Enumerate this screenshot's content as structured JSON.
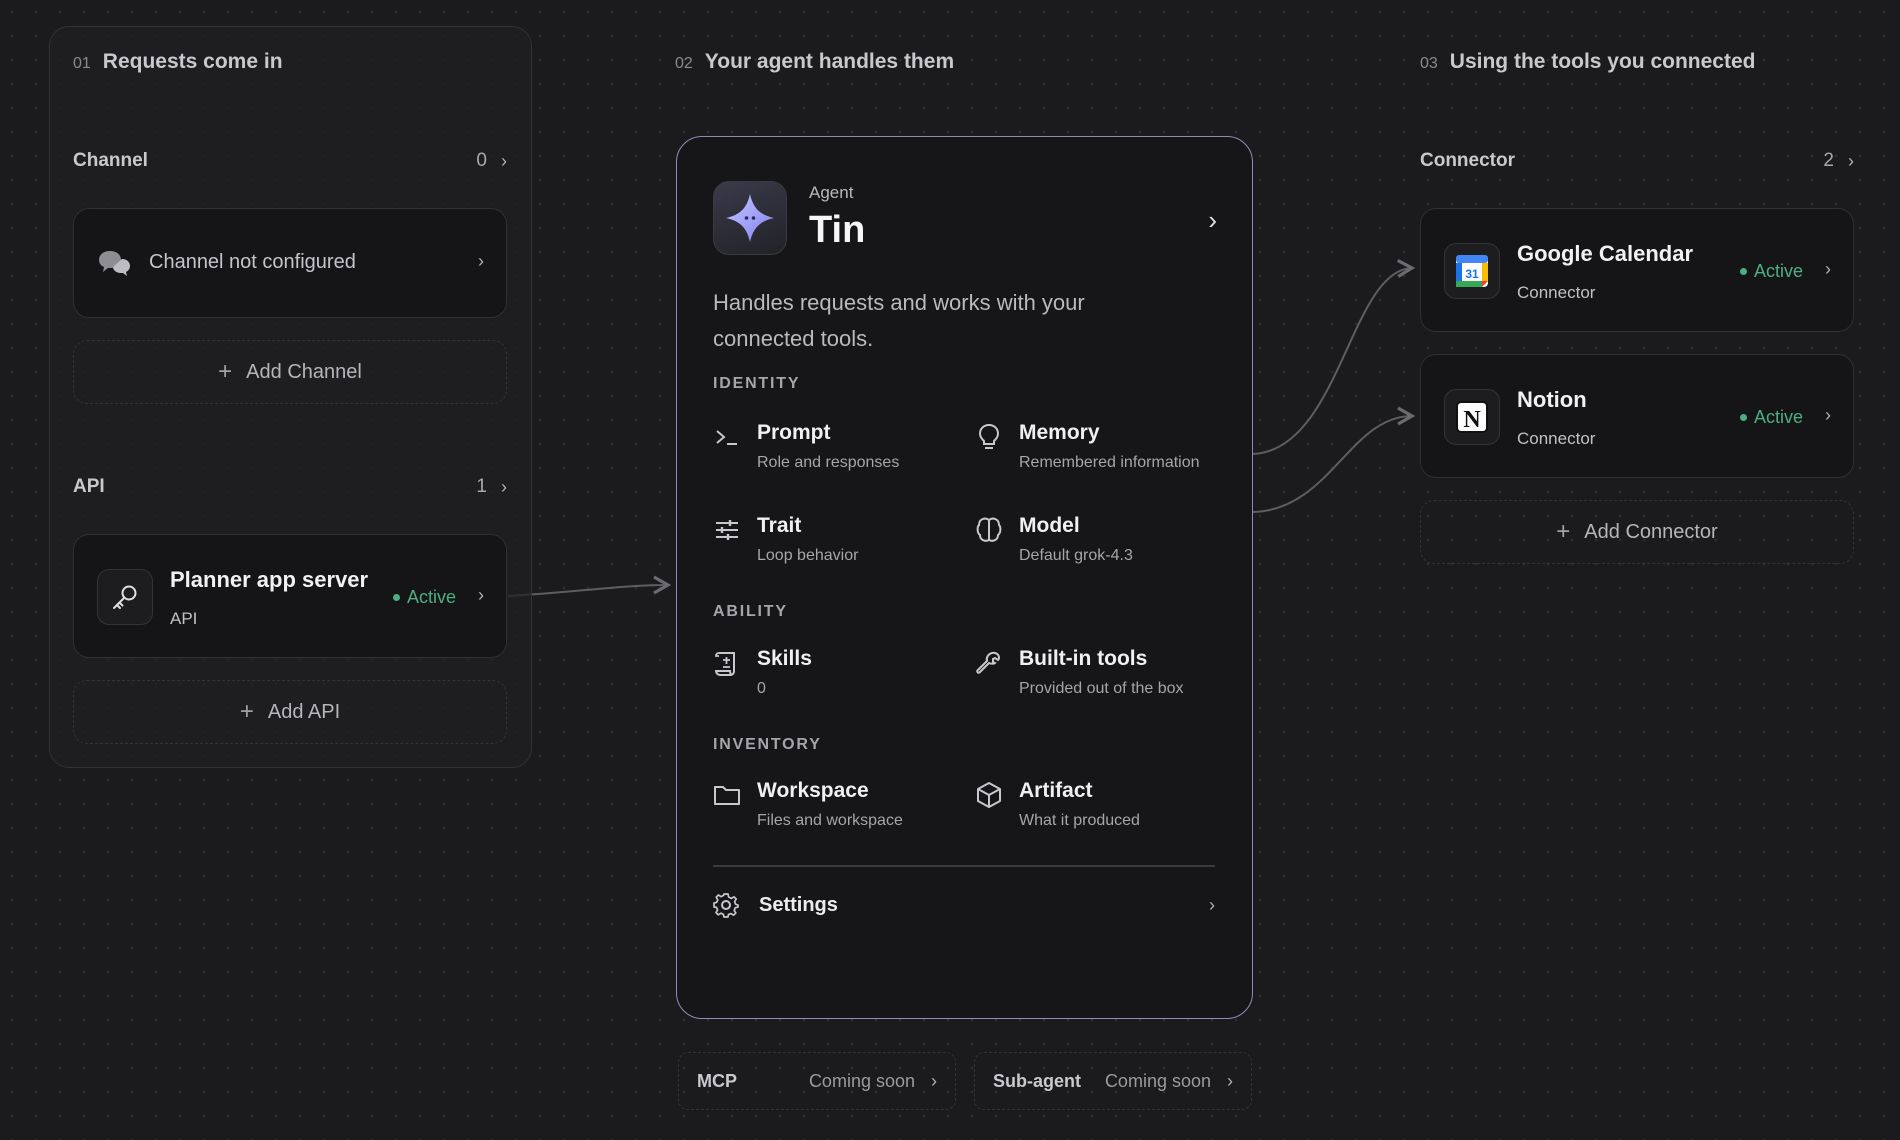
{
  "steps": [
    {
      "num": "01",
      "title": "Requests come in"
    },
    {
      "num": "02",
      "title": "Your agent handles them"
    },
    {
      "num": "03",
      "title": "Using the tools you connected"
    }
  ],
  "channel": {
    "label": "Channel",
    "count": "0",
    "empty_card": {
      "text": "Channel not configured",
      "icon": "chat-bubbles-icon"
    },
    "add_label": "Add Channel"
  },
  "api": {
    "label": "API",
    "count": "1",
    "card": {
      "title": "Planner app server",
      "subtitle": "API",
      "status": "Active",
      "icon": "key-icon"
    },
    "add_label": "Add API"
  },
  "agent": {
    "kicker": "Agent",
    "name": "Tin",
    "description": "Handles requests and works with your connected tools.",
    "avatar": "sparkle-star-avatar",
    "sections": {
      "identity": "IDENTITY",
      "ability": "ABILITY",
      "inventory": "INVENTORY"
    },
    "items": {
      "prompt": {
        "title": "Prompt",
        "subtitle": "Role and responses",
        "icon": "terminal-icon"
      },
      "memory": {
        "title": "Memory",
        "subtitle": "Remembered information",
        "icon": "lightbulb-icon"
      },
      "trait": {
        "title": "Trait",
        "subtitle": "Loop behavior",
        "icon": "sliders-icon"
      },
      "model": {
        "title": "Model",
        "subtitle": "Default grok-4.3",
        "icon": "brain-icon"
      },
      "skills": {
        "title": "Skills",
        "subtitle": "0",
        "icon": "scroll-icon"
      },
      "builtin": {
        "title": "Built-in tools",
        "subtitle": "Provided out of the box",
        "icon": "wrench-icon"
      },
      "workspace": {
        "title": "Workspace",
        "subtitle": "Files and workspace",
        "icon": "folder-icon"
      },
      "artifact": {
        "title": "Artifact",
        "subtitle": "What it produced",
        "icon": "cube-icon"
      }
    },
    "settings_label": "Settings"
  },
  "coming": [
    {
      "name": "MCP",
      "status": "Coming soon"
    },
    {
      "name": "Sub-agent",
      "status": "Coming soon"
    }
  ],
  "connector": {
    "label": "Connector",
    "count": "2",
    "items": [
      {
        "title": "Google Calendar",
        "subtitle": "Connector",
        "status": "Active",
        "icon": "google-calendar-icon",
        "badge": "31"
      },
      {
        "title": "Notion",
        "subtitle": "Connector",
        "status": "Active",
        "icon": "notion-icon",
        "badge": "N"
      }
    ],
    "add_label": "Add Connector"
  },
  "colors": {
    "accent_border": "#8f8cb8",
    "active_green": "#4caf82",
    "background": "#1b1b1d"
  }
}
